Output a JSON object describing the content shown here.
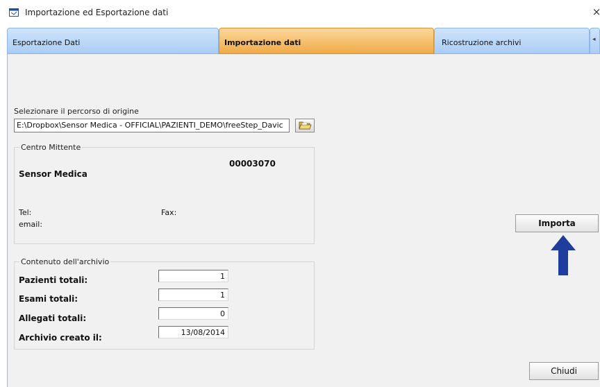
{
  "window": {
    "title": "Importazione ed Esportazione dati",
    "close_glyph": "×"
  },
  "tabs": [
    {
      "label": "Esportazione Dati",
      "active": false
    },
    {
      "label": "Importazione dati",
      "active": true
    },
    {
      "label": "Ricostruzione archivi",
      "active": false
    }
  ],
  "tab_scroll_glyph": "◂",
  "origin": {
    "label": "Selezionare il percorso di origine",
    "path": "E:\\Dropbox\\Sensor Medica - OFFICIAL\\PAZIENTI_DEMO\\freeStep_Davic"
  },
  "centro": {
    "legend": "Centro Mittente",
    "code": "00003070",
    "name": "Sensor Medica",
    "tel_label": "Tel:",
    "fax_label": "Fax:",
    "email_label": "email:"
  },
  "contenuto": {
    "legend": "Contenuto dell'archivio",
    "rows": [
      {
        "label": "Pazienti totali:",
        "value": "1"
      },
      {
        "label": "Esami totali:",
        "value": "1"
      },
      {
        "label": "Allegati totali:",
        "value": "0"
      },
      {
        "label": "Archivio creato il:",
        "value": "13/08/2014"
      }
    ]
  },
  "buttons": {
    "importa": "Importa",
    "chiudi": "Chiudi"
  },
  "colors": {
    "active_tab": "#f0aa48",
    "inactive_tab": "#aacdf5",
    "arrow": "#1f3d9c"
  },
  "icons": {
    "app": "window-app-icon",
    "browse": "folder-open-icon",
    "arrow": "arrow-up-icon"
  }
}
